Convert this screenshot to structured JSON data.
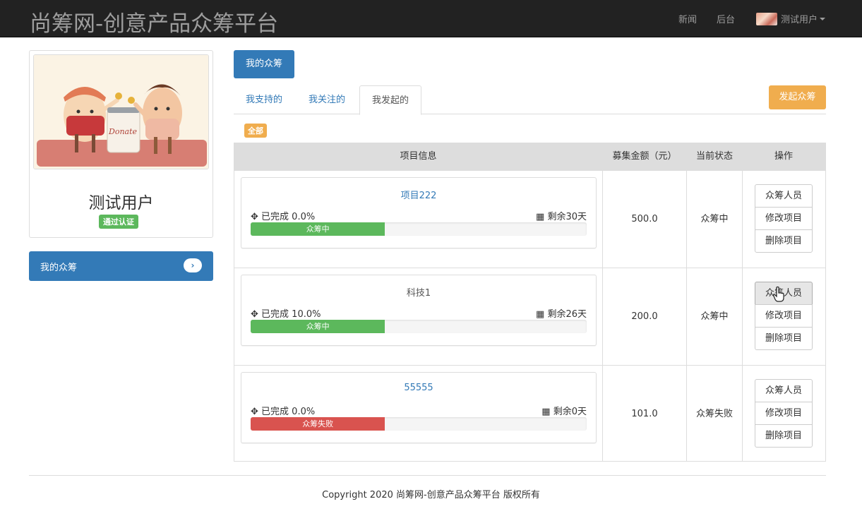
{
  "navbar": {
    "brand": "尚筹网-创意产品众筹平台",
    "links": [
      "新闻",
      "后台"
    ],
    "user": "测试用户"
  },
  "profile": {
    "name": "测试用户",
    "badge": "通过认证",
    "image_text": "Donate"
  },
  "sidebar": {
    "item": "我的众筹",
    "chevron": "›"
  },
  "main": {
    "title_button": "我的众筹",
    "tabs": [
      "我支持的",
      "我关注的",
      "我发起的"
    ],
    "active_tab": "我发起的",
    "launch_button": "发起众筹",
    "filter_badge": "全部",
    "table": {
      "headers": [
        "项目信息",
        "募集金额（元）",
        "当前状态",
        "操作"
      ],
      "rows": [
        {
          "title": "项目222",
          "done": "已完成 0.0%",
          "remaining": "剩余30天",
          "bar_label": "众筹中",
          "bar_fraction": 0.4,
          "bar_color": "#5cb85c",
          "amount": "500.0",
          "status": "众筹中",
          "ops": [
            "众筹人员",
            "修改项目",
            "删除项目"
          ]
        },
        {
          "title": "科技1",
          "done": "已完成 10.0%",
          "remaining": "剩余26天",
          "bar_label": "众筹中",
          "bar_fraction": 0.4,
          "bar_color": "#5cb85c",
          "amount": "200.0",
          "status": "众筹中",
          "ops": [
            "众筹人员",
            "修改项目",
            "删除项目"
          ]
        },
        {
          "title": "55555",
          "done": "已完成 0.0%",
          "remaining": "剩余0天",
          "bar_label": "众筹失败",
          "bar_fraction": 0.4,
          "bar_color": "#d9534f",
          "amount": "101.0",
          "status": "众筹失败",
          "ops": [
            "众筹人员",
            "修改项目",
            "删除项目"
          ]
        }
      ]
    }
  },
  "footer": "Copyright 2020 尚筹网-创意产品众筹平台 版权所有",
  "colors": {
    "primary": "#337ab7",
    "warning": "#f0ad4e",
    "success": "#5cb85c",
    "danger": "#d9534f",
    "navbar": "#222222"
  },
  "icons": {
    "done": "crosshair-icon",
    "remaining": "calendar-icon",
    "chevron": "chevron-right-icon"
  }
}
